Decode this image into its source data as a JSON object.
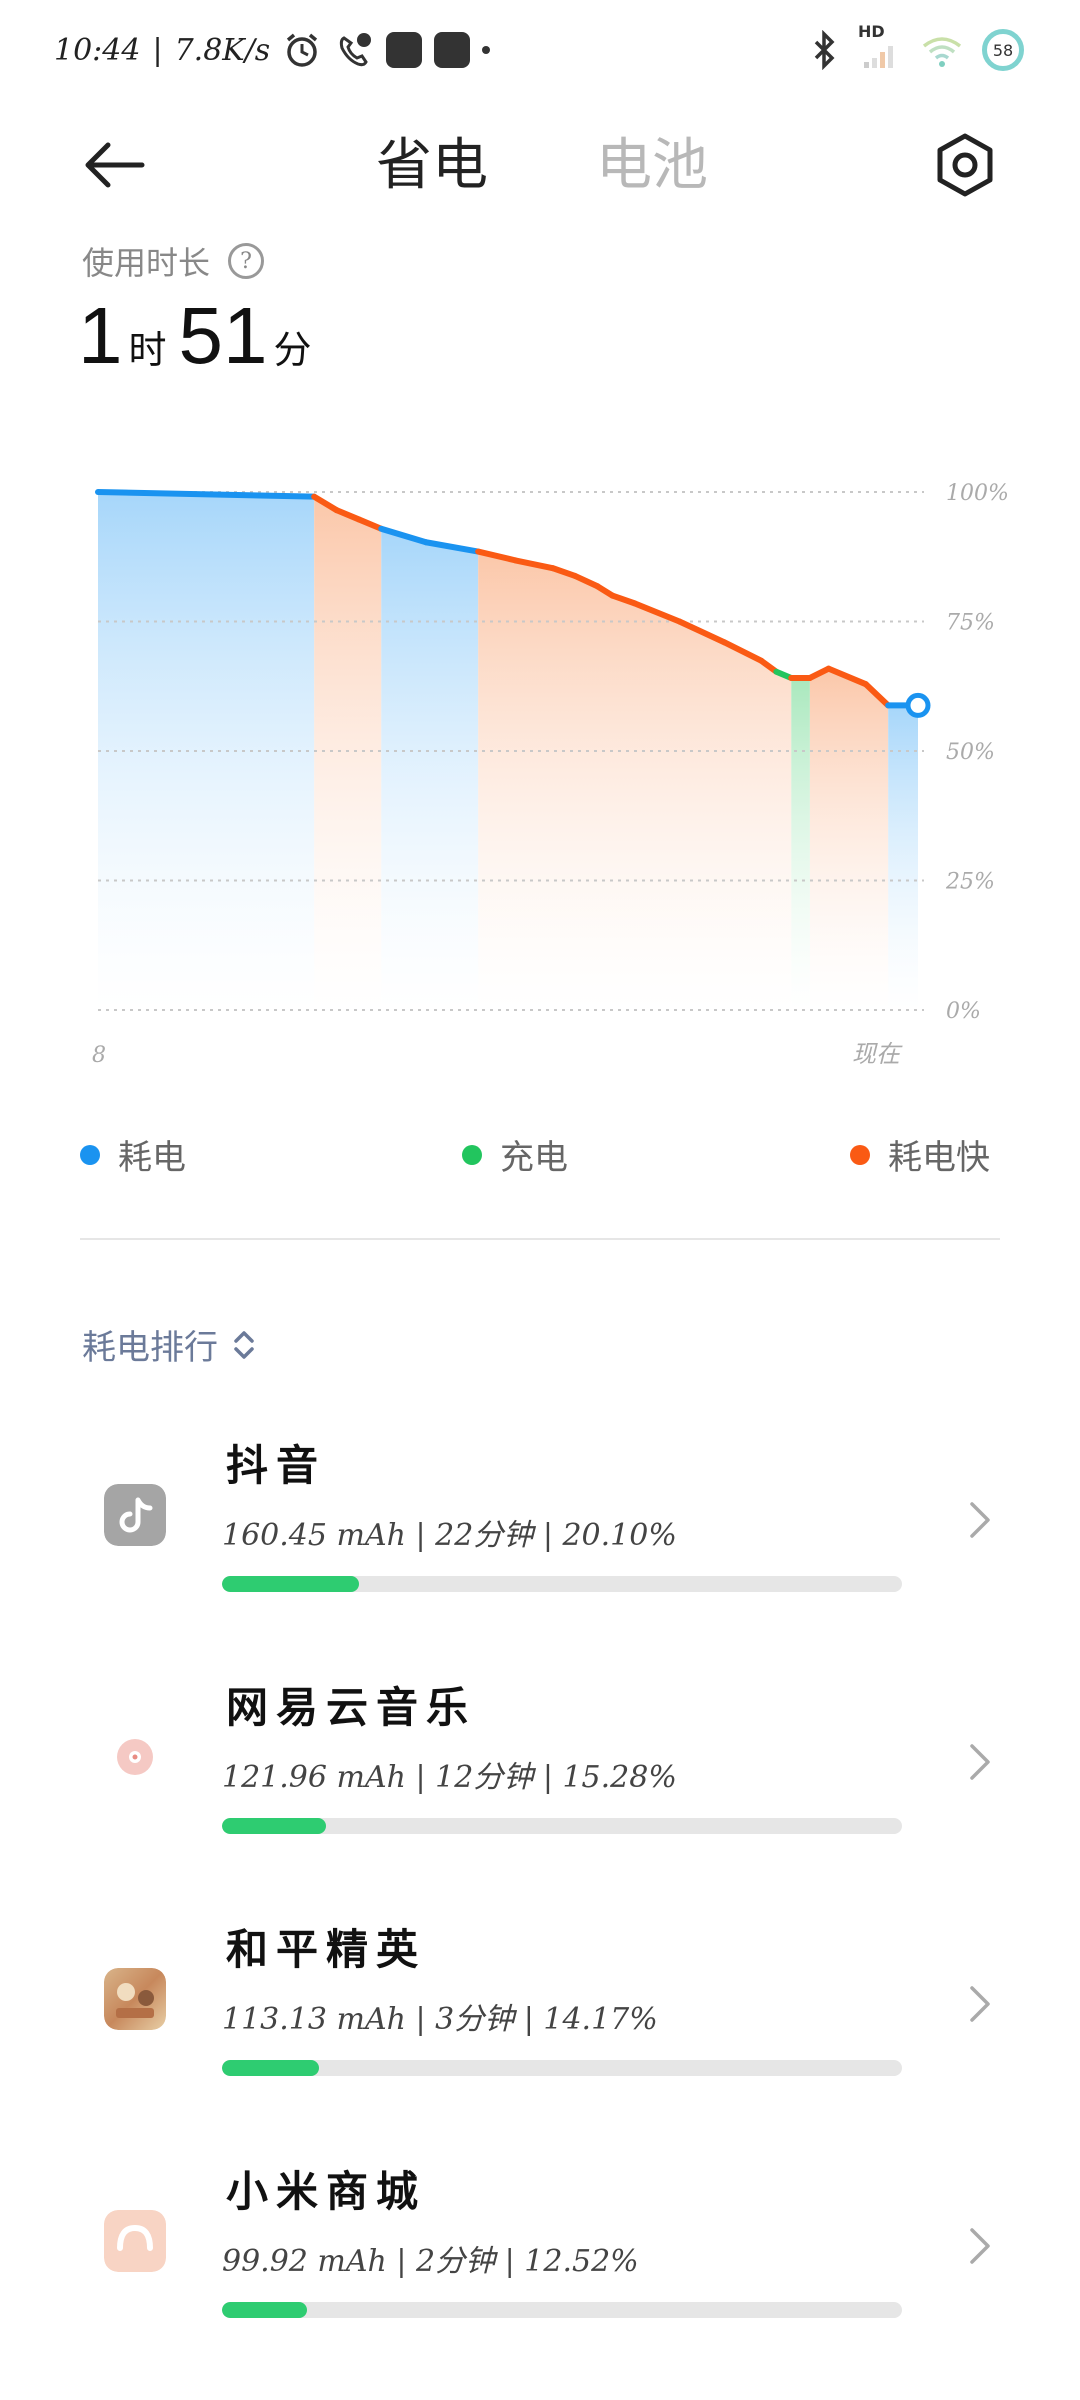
{
  "status_bar": {
    "time": "10:44",
    "speed": "7.8K/s",
    "hd_label": "HD",
    "battery_level": "58"
  },
  "header": {
    "tab_save_power": "省电",
    "tab_battery": "电池"
  },
  "usage": {
    "label": "使用时长",
    "hours": "1",
    "hours_unit": "时",
    "minutes": "51",
    "minutes_unit": "分"
  },
  "chart_data": {
    "type": "area",
    "y_tick_labels": [
      "100%",
      "75%",
      "50%",
      "25%",
      "0%"
    ],
    "x_tick_labels": [
      "8",
      "现在"
    ],
    "ylim": [
      0,
      100
    ],
    "grid": true,
    "legend_position": "bottom",
    "series_colors": {
      "discharge": "#1a93f0",
      "charging": "#22c55e",
      "fast_discharge": "#fa5a14"
    },
    "points": [
      {
        "t": 0,
        "y": 100,
        "state": "discharge"
      },
      {
        "t": 29,
        "y": 99.1,
        "state": "discharge"
      },
      {
        "t": 32,
        "y": 96.5,
        "state": "fast_discharge"
      },
      {
        "t": 35,
        "y": 94.7,
        "state": "fast_discharge"
      },
      {
        "t": 38,
        "y": 92.9,
        "state": "fast_discharge"
      },
      {
        "t": 44,
        "y": 90.3,
        "state": "discharge"
      },
      {
        "t": 51,
        "y": 88.5,
        "state": "discharge"
      },
      {
        "t": 56,
        "y": 86.8,
        "state": "fast_discharge"
      },
      {
        "t": 61,
        "y": 85.3,
        "state": "fast_discharge"
      },
      {
        "t": 64,
        "y": 83.8,
        "state": "fast_discharge"
      },
      {
        "t": 67,
        "y": 81.8,
        "state": "fast_discharge"
      },
      {
        "t": 69,
        "y": 80.0,
        "state": "fast_discharge"
      },
      {
        "t": 72,
        "y": 78.5,
        "state": "fast_discharge"
      },
      {
        "t": 78,
        "y": 75.0,
        "state": "fast_discharge"
      },
      {
        "t": 84,
        "y": 71.0,
        "state": "fast_discharge"
      },
      {
        "t": 89,
        "y": 67.4,
        "state": "fast_discharge"
      },
      {
        "t": 91,
        "y": 65.3,
        "state": "fast_discharge"
      },
      {
        "t": 93,
        "y": 64.1,
        "state": "charging"
      },
      {
        "t": 95.5,
        "y": 64.1,
        "state": "fast_discharge"
      },
      {
        "t": 98,
        "y": 65.9,
        "state": "fast_discharge"
      },
      {
        "t": 103,
        "y": 62.9,
        "state": "fast_discharge"
      },
      {
        "t": 106,
        "y": 58.8,
        "state": "fast_discharge"
      },
      {
        "t": 110,
        "y": 58.8,
        "state": "discharge"
      }
    ],
    "bands": [
      {
        "from": 0,
        "to": 29,
        "state": "discharge"
      },
      {
        "from": 29,
        "to": 38,
        "state": "fast_discharge"
      },
      {
        "from": 38,
        "to": 51,
        "state": "discharge"
      },
      {
        "from": 51,
        "to": 93,
        "state": "fast_discharge"
      },
      {
        "from": 93,
        "to": 95.5,
        "state": "charging"
      },
      {
        "from": 95.5,
        "to": 106,
        "state": "fast_discharge"
      },
      {
        "from": 106,
        "to": 110,
        "state": "discharge"
      }
    ],
    "x_range": [
      0,
      110
    ]
  },
  "legend": {
    "discharge": "耗电",
    "charging": "充电",
    "fast_discharge": "耗电快"
  },
  "ranking": {
    "title": "耗电排行"
  },
  "apps": [
    {
      "name": "抖音",
      "stats": "160.45 mAh | 22分钟 | 20.10%",
      "percent": 20.1,
      "icon": "douyin-icon"
    },
    {
      "name": "网易云音乐",
      "stats": "121.96 mAh | 12分钟 | 15.28%",
      "percent": 15.28,
      "icon": "netease-music-icon"
    },
    {
      "name": "和平精英",
      "stats": "113.13 mAh | 3分钟 | 14.17%",
      "percent": 14.17,
      "icon": "peace-elite-icon"
    },
    {
      "name": "小米商城",
      "stats": "99.92 mAh | 2分钟 | 12.52%",
      "percent": 12.52,
      "icon": "mi-store-icon"
    }
  ]
}
